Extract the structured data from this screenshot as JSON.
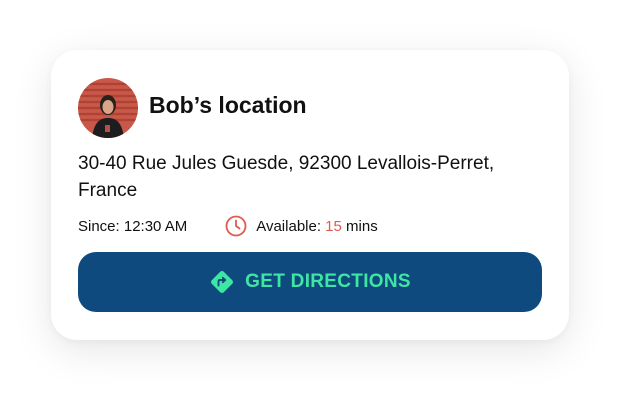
{
  "card": {
    "avatar_alt": "Bob",
    "title": "Bob’s location",
    "address": "30-40 Rue Jules Guesde, 92300 Levallois-Perret, France",
    "since_label": "Since: 12:30 AM",
    "available_prefix": "Available: ",
    "available_minutes": "15",
    "available_suffix": " mins",
    "button_label": "GET DIRECTIONS",
    "icons": {
      "clock": "clock-icon",
      "directions": "directions-icon"
    },
    "colors": {
      "button_bg": "#0e4a7e",
      "button_text": "#3ee6a3",
      "accent_red": "#e05a4e"
    }
  }
}
